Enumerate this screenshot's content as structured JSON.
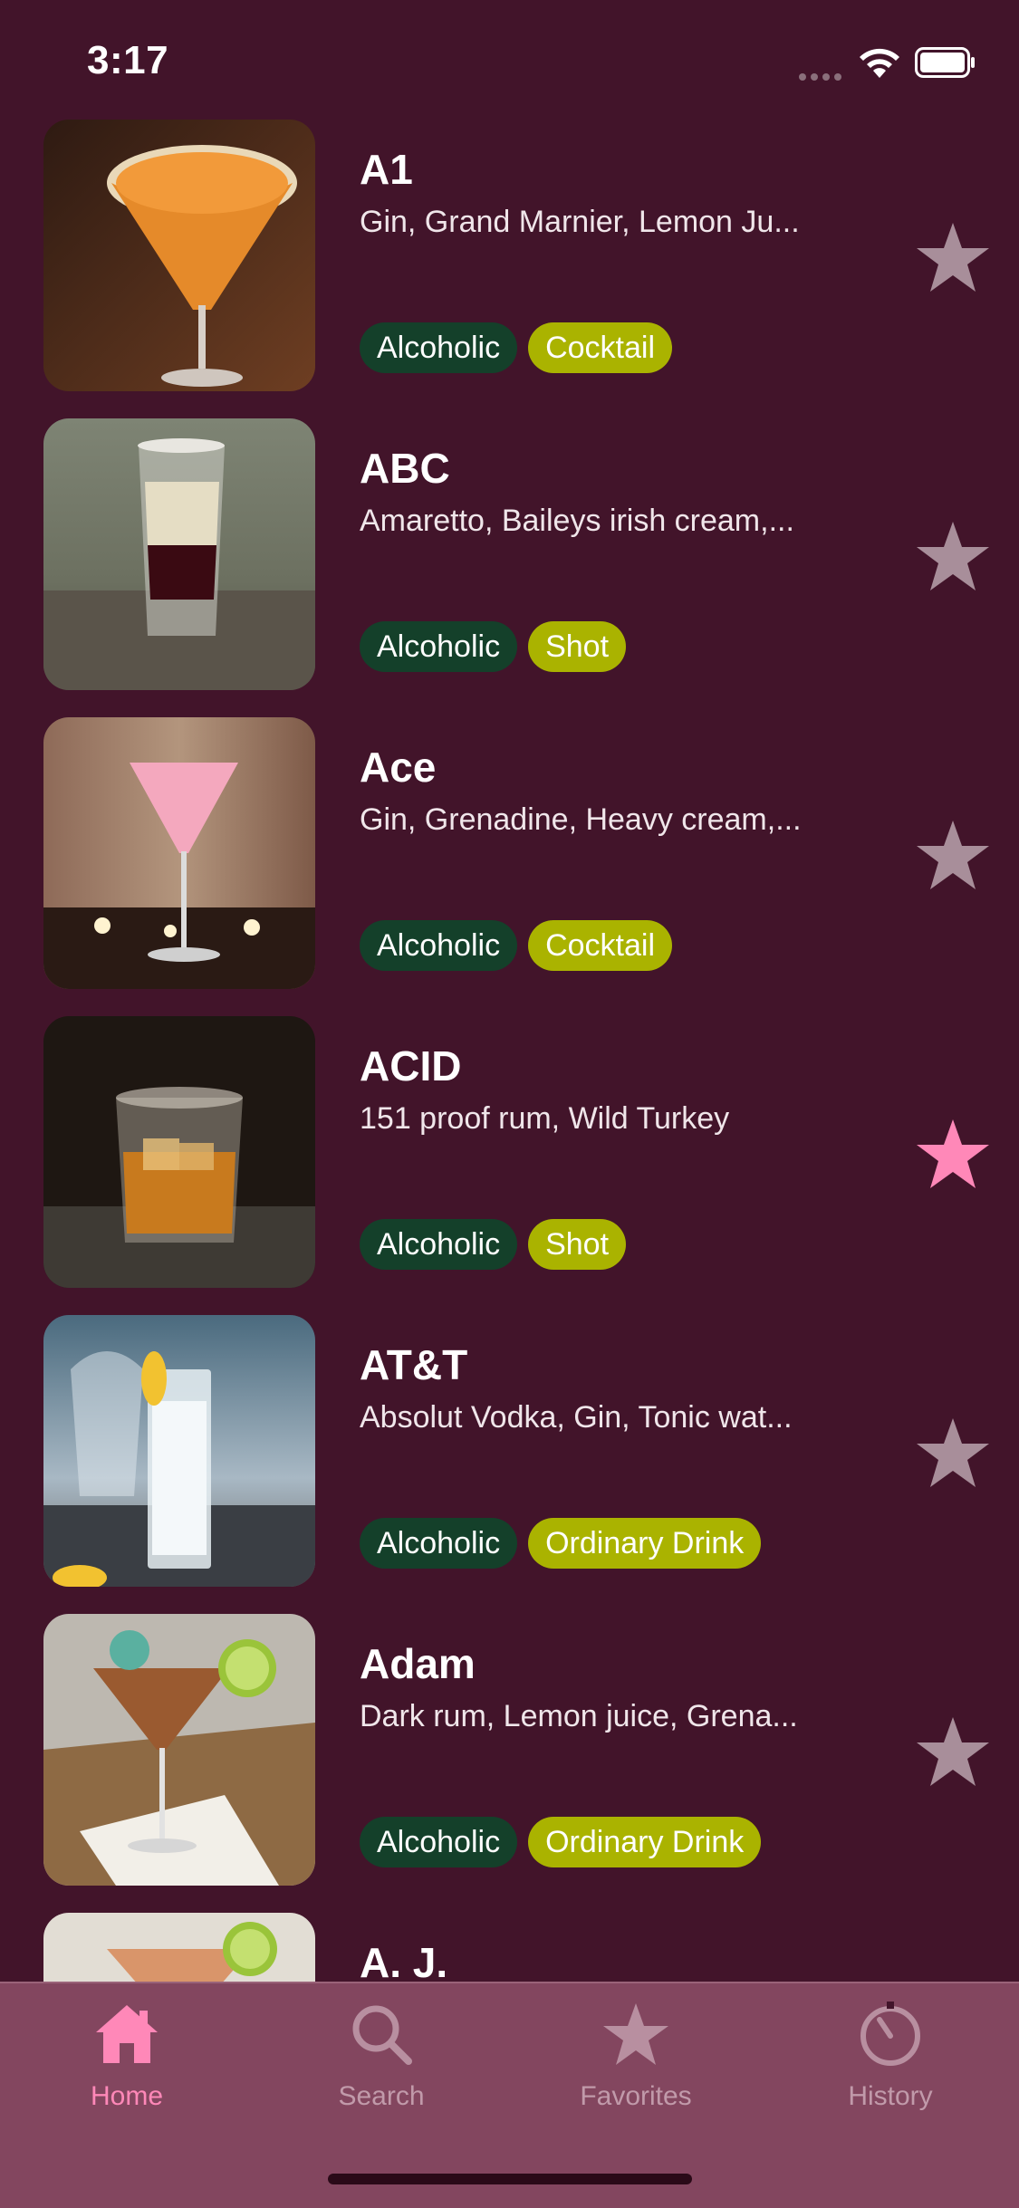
{
  "status_bar": {
    "time": "3:17"
  },
  "drinks": [
    {
      "name": "A1",
      "ingredients": "Gin, Grand Marnier, Lemon Ju...",
      "alcoholic": "Alcoholic",
      "category": "Cocktail",
      "favorite": false
    },
    {
      "name": "ABC",
      "ingredients": "Amaretto, Baileys irish cream,...",
      "alcoholic": "Alcoholic",
      "category": "Shot",
      "favorite": false
    },
    {
      "name": "Ace",
      "ingredients": "Gin, Grenadine, Heavy cream,...",
      "alcoholic": "Alcoholic",
      "category": "Cocktail",
      "favorite": false
    },
    {
      "name": "ACID",
      "ingredients": "151 proof rum, Wild Turkey",
      "alcoholic": "Alcoholic",
      "category": "Shot",
      "favorite": true
    },
    {
      "name": "AT&T",
      "ingredients": "Absolut Vodka, Gin, Tonic wat...",
      "alcoholic": "Alcoholic",
      "category": "Ordinary Drink",
      "favorite": false
    },
    {
      "name": "Adam",
      "ingredients": "Dark rum, Lemon juice, Grena...",
      "alcoholic": "Alcoholic",
      "category": "Ordinary Drink",
      "favorite": false
    },
    {
      "name": "A. J.",
      "ingredients": "",
      "alcoholic": "",
      "category": "",
      "favorite": false
    }
  ],
  "tab_bar": {
    "tabs": [
      {
        "label": "Home",
        "icon": "home-icon",
        "active": true
      },
      {
        "label": "Search",
        "icon": "search-icon",
        "active": false
      },
      {
        "label": "Favorites",
        "icon": "star-icon",
        "active": false
      },
      {
        "label": "History",
        "icon": "history-icon",
        "active": false
      }
    ]
  },
  "colors": {
    "background": "#42142a",
    "tab_bar": "#83465f",
    "accent_pink": "#ff88b8",
    "tag_alcoholic": "#14402a",
    "tag_category": "#aab300",
    "star_inactive": "#a88e9a"
  }
}
